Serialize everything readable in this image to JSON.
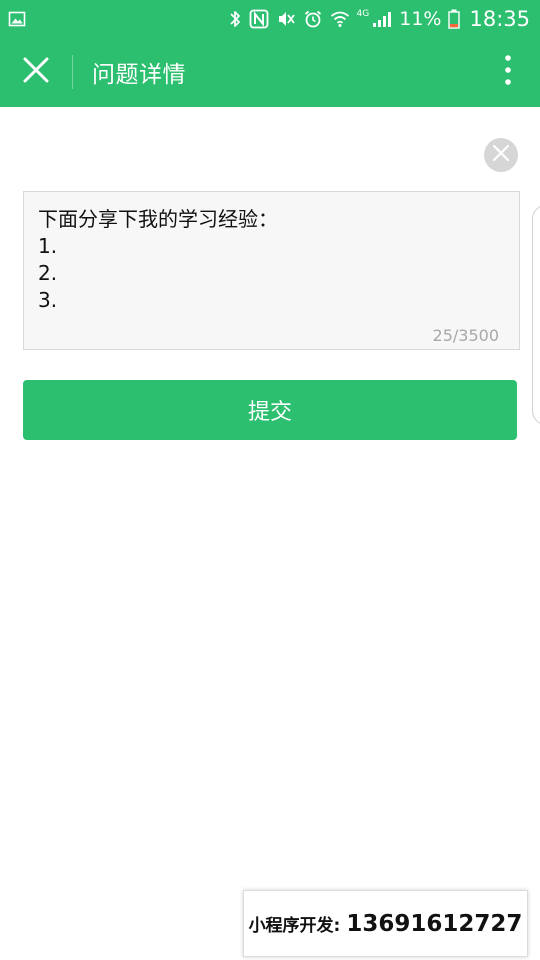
{
  "status_bar": {
    "battery_percent": "11%",
    "time": "18:35",
    "network": "4G"
  },
  "nav": {
    "title": "问题详情"
  },
  "editor": {
    "lines": "下面分享下我的学习经验：\n1.\n2.\n3.",
    "char_count": "25/3500"
  },
  "submit": {
    "label": "提交"
  },
  "promo": {
    "label": "小程序开发:",
    "phone": "13691612727"
  },
  "colors": {
    "brand_green": "#2bbf6f",
    "clear_gray": "#d6d6d6",
    "box_bg": "#f7f7f7"
  },
  "icons": [
    "image-icon",
    "bluetooth-icon",
    "nfc-icon",
    "mute-icon",
    "alarm-icon",
    "wifi-icon",
    "signal-icon",
    "battery-icon",
    "close-icon",
    "more-icon",
    "clear-icon"
  ]
}
